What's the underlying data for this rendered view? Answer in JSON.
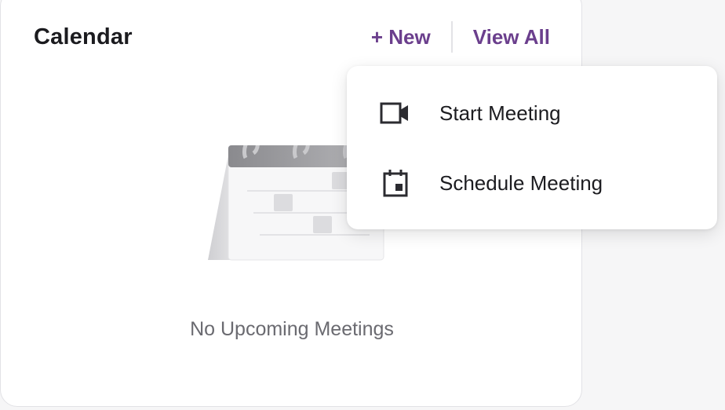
{
  "card": {
    "title": "Calendar",
    "new_label": "+ New",
    "view_all_label": "View All",
    "empty_message": "No Upcoming Meetings"
  },
  "menu": {
    "items": [
      {
        "label": "Start Meeting",
        "icon": "video-camera-icon"
      },
      {
        "label": "Schedule Meeting",
        "icon": "calendar-schedule-icon"
      }
    ]
  },
  "colors": {
    "accent": "#6b3f8d",
    "text_primary": "#1b1b1f",
    "text_muted": "#6a6a70"
  }
}
